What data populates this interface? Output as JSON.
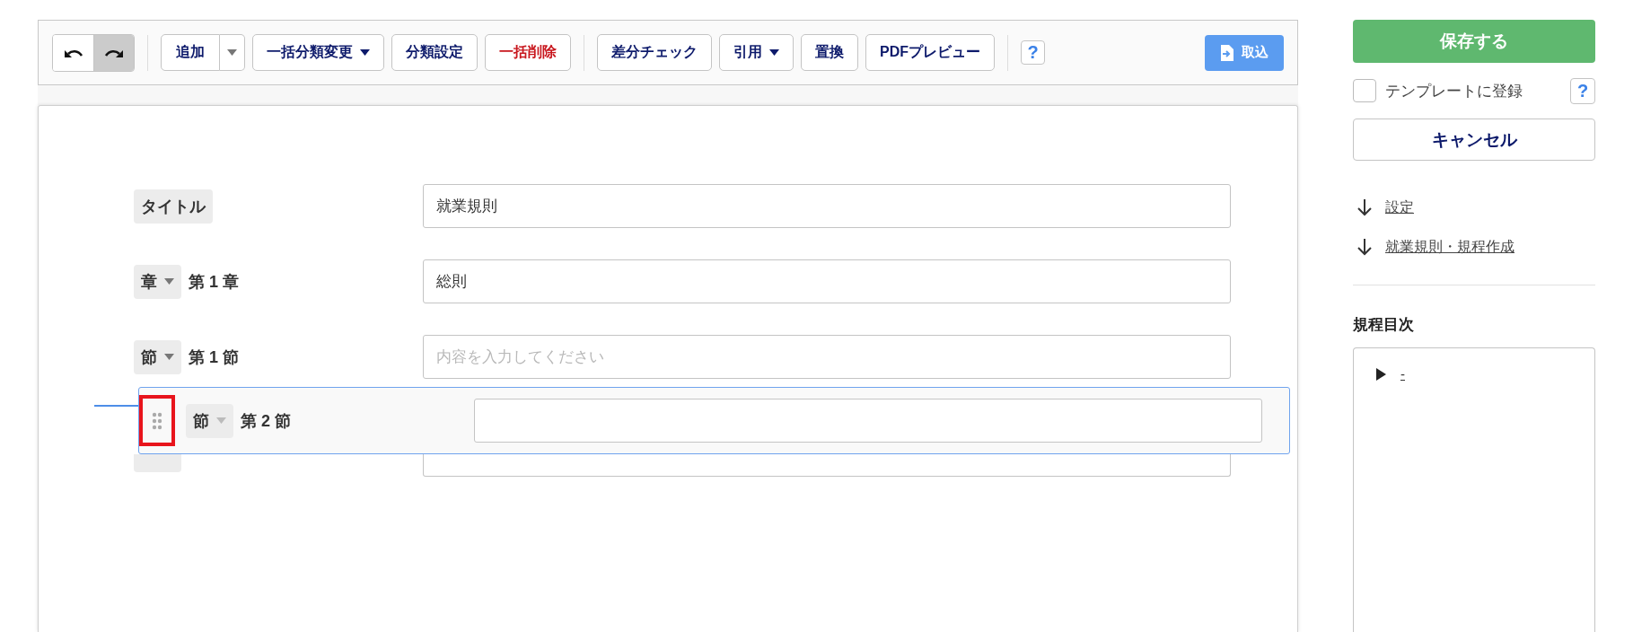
{
  "toolbar": {
    "history": [
      {
        "kind": "undo",
        "pressed": false
      },
      {
        "kind": "redo",
        "pressed": true
      }
    ],
    "groups": [
      [
        {
          "kind": "split",
          "label": "追加"
        },
        {
          "kind": "dropdown",
          "label": "一括分類変更"
        },
        {
          "kind": "plain",
          "label": "分類設定"
        },
        {
          "kind": "danger",
          "label": "一括削除"
        }
      ],
      [
        {
          "kind": "plain",
          "label": "差分チェック"
        },
        {
          "kind": "dropdown",
          "label": "引用"
        },
        {
          "kind": "plain",
          "label": "置換"
        },
        {
          "kind": "plain",
          "label": "PDFプレビュー"
        }
      ],
      [
        {
          "kind": "help",
          "label": "?"
        }
      ]
    ],
    "import_button": {
      "label": "取込"
    }
  },
  "rows": [
    {
      "kind": "plain",
      "tag": "タイトル",
      "value": "就業規則"
    },
    {
      "kind": "select",
      "tag": "章",
      "number": "第 1 章",
      "value": "総則"
    },
    {
      "kind": "select",
      "tag": "節",
      "number": "第 1 節",
      "placeholder": "内容を入力してください"
    },
    {
      "kind": "covered"
    }
  ],
  "dragged_row": {
    "tag": "節",
    "number": "第 2 節",
    "highlighted": true
  },
  "sidebar": {
    "save_button": "保存する",
    "template": {
      "label": "テンプレートに登録",
      "checked": false,
      "help": "?"
    },
    "cancel_button": "キャンセル",
    "links": [
      "設定",
      "就業規則・規程作成"
    ],
    "toc_title": "規程目次",
    "toc": [
      {
        "label": "-",
        "expanded": false
      }
    ]
  }
}
